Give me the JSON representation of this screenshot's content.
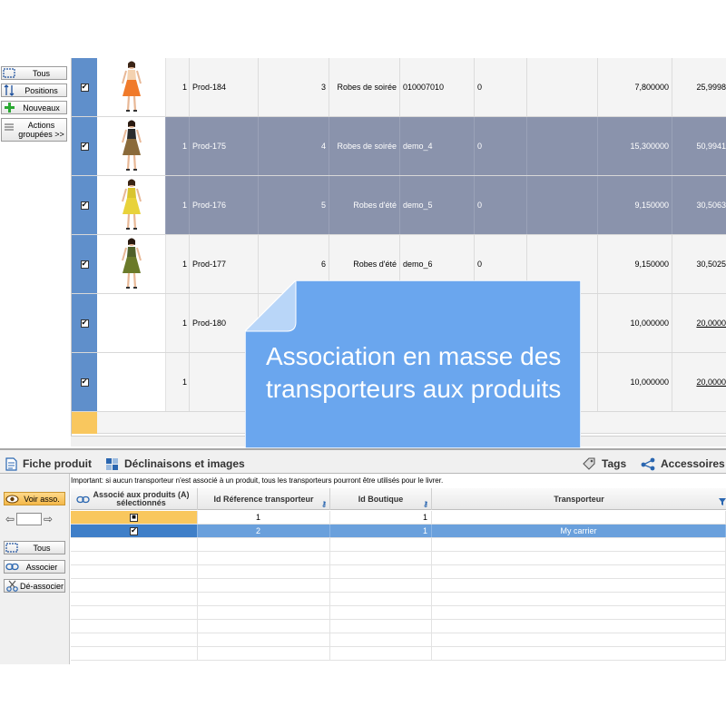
{
  "toolbar_top": {
    "all_label": "Tous",
    "positions_label": "Positions",
    "new_label": "Nouveaux",
    "bulk_actions_label": "Actions groupées >>"
  },
  "products": [
    {
      "checked": true,
      "number": "1",
      "ref": "Prod-184",
      "position": "3",
      "category": "Robes de soirée",
      "ean": "010007010",
      "stock": "0",
      "weight": "7,800000",
      "price": "25,9998",
      "selected": false,
      "figure": "orange"
    },
    {
      "checked": true,
      "number": "1",
      "ref": "Prod-175",
      "position": "4",
      "category": "Robes de soirée",
      "ean": "demo_4",
      "stock": "0",
      "weight": "15,300000",
      "price": "50,9941",
      "selected": true,
      "figure": "leopard"
    },
    {
      "checked": true,
      "number": "1",
      "ref": "Prod-176",
      "position": "5",
      "category": "Robes d'été",
      "ean": "demo_5",
      "stock": "0",
      "weight": "9,150000",
      "price": "30,5063",
      "selected": true,
      "figure": "yellow"
    },
    {
      "checked": true,
      "number": "1",
      "ref": "Prod-177",
      "position": "6",
      "category": "Robes d'été",
      "ean": "demo_6",
      "stock": "0",
      "weight": "9,150000",
      "price": "30,5025",
      "selected": false,
      "figure": "green"
    },
    {
      "checked": true,
      "number": "1",
      "ref": "Prod-180",
      "position": "",
      "category": "",
      "ean": "",
      "stock": "",
      "weight": "10,000000",
      "price": "20,0000",
      "selected": false,
      "figure": ""
    },
    {
      "checked": true,
      "number": "1",
      "ref": "",
      "position": "",
      "category": "",
      "ean": "",
      "stock": "",
      "weight": "10,000000",
      "price": "20,0000",
      "selected": false,
      "figure": ""
    }
  ],
  "tabs": {
    "product_sheet": "Fiche produit",
    "combinations": "Déclinaisons et images",
    "tags": "Tags",
    "accessories": "Accessoires"
  },
  "important_note": "Important: si aucun transporteur n'est associé à un produit, tous les transporteurs pourront être utilisés pour le livrer.",
  "toolbar_bottom": {
    "show_assoc_label": "Voir asso.",
    "page_value": "",
    "all_label": "Tous",
    "associate_label": "Associer",
    "dissociate_label": "Dé-associer"
  },
  "carrier_grid": {
    "headers": {
      "assoc": "Associé aux produits (A) sélectionnés",
      "id_ref": "Id Réference transporteur",
      "id_shop": "Id Boutique",
      "carrier": "Transporteur"
    },
    "rows": [
      {
        "assoc_mark": "■",
        "id_ref": "1",
        "id_shop": "1",
        "carrier": ""
      },
      {
        "assoc_mark": "✔",
        "id_ref": "2",
        "id_shop": "1",
        "carrier": "My carrier"
      }
    ]
  },
  "callout": {
    "text": "Association en masse des transporteurs aux produits",
    "color": "#6aa6ee"
  },
  "colors": {
    "selected_row": "#8a93ac",
    "selection_column": "#5f8fcb",
    "highlight_yellow": "#f9c75e",
    "selected_blue": "#6aa0dc"
  }
}
